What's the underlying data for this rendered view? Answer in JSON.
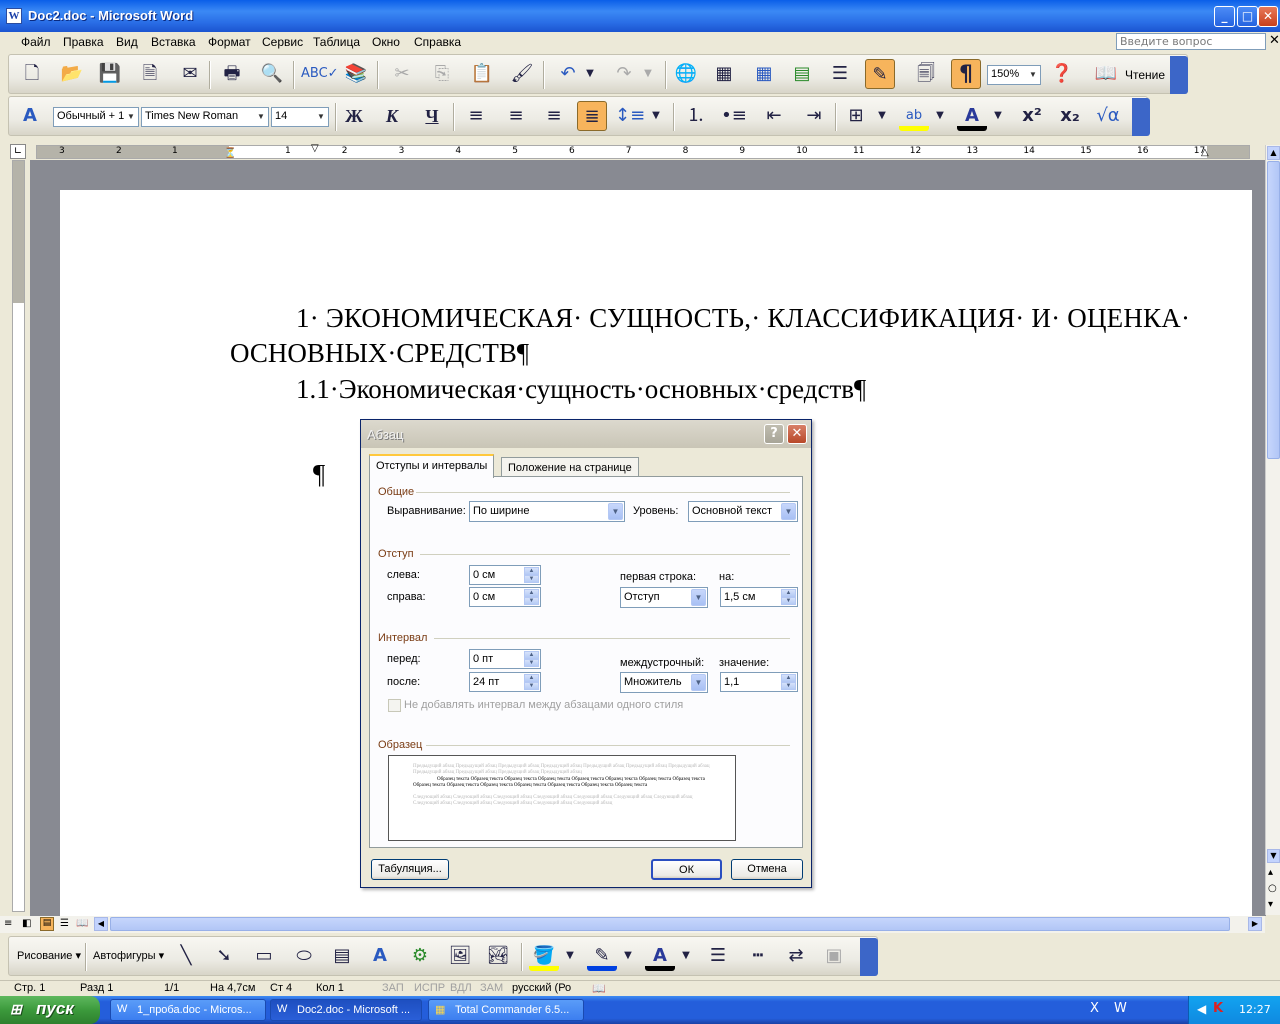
{
  "window": {
    "title": "Doc2.doc - Microsoft Word"
  },
  "menu": {
    "items": [
      "Файл",
      "Правка",
      "Вид",
      "Вставка",
      "Формат",
      "Сервис",
      "Таблица",
      "Окно",
      "Справка"
    ],
    "ask_placeholder": "Введите вопрос"
  },
  "toolbar": {
    "zoom": "150%",
    "reading_label": "Чтение"
  },
  "format_toolbar": {
    "style": "Обычный + 1",
    "font": "Times New Roman",
    "size": "14"
  },
  "ruler": {
    "numbers_left": [
      "3",
      "2",
      "1"
    ],
    "numbers_right": [
      "1",
      "2",
      "3",
      "4",
      "5",
      "6",
      "7",
      "8",
      "9",
      "10",
      "11",
      "12",
      "13",
      "14",
      "15",
      "16",
      "17"
    ]
  },
  "document": {
    "heading_line1": "1· ЭКОНОМИЧЕСКАЯ· СУЩНОСТЬ,· КЛАССИФИКАЦИЯ· И· ОЦЕНКА·",
    "heading_line2": "ОСНОВНЫХ·СРЕДСТВ¶",
    "subheading": "1.1·Экономическая·сущность·основных·средств¶",
    "empty_para": "¶"
  },
  "dialog": {
    "title": "Абзац",
    "tabs": [
      "Отступы и интервалы",
      "Положение на странице"
    ],
    "general": {
      "label": "Общие",
      "alignment_label": "Выравнивание:",
      "alignment_value": "По ширине",
      "level_label": "Уровень:",
      "level_value": "Основной текст"
    },
    "indent": {
      "label": "Отступ",
      "left_label": "слева:",
      "left_value": "0 см",
      "right_label": "справа:",
      "right_value": "0 см",
      "first_line_label": "первая строка:",
      "first_line_value": "Отступ",
      "by_label": "на:",
      "by_value": "1,5 см"
    },
    "spacing": {
      "label": "Интервал",
      "before_label": "перед:",
      "before_value": "0 пт",
      "after_label": "после:",
      "after_value": "24 пт",
      "line_label": "междустрочный:",
      "line_value": "Множитель",
      "at_label": "значение:",
      "at_value": "1,1",
      "no_space_label": "Не добавлять интервал между абзацами одного стиля"
    },
    "preview": {
      "label": "Образец",
      "prev": "Предыдущий абзац Предыдущий абзац Предыдущий абзац Предыдущий абзац Предыдущий абзац Предыдущий абзац Предыдущий абзац Предыдущий абзац Предыдущий абзац Предыдущий абзац Предыдущий абзац",
      "sample": "Образец текста Образец текста Образец текста Образец текста Образец текста Образец текста Образец текста Образец текста Образец текста Образец текста Образец текста Образец текста Образец текста Образец текста Образец текста",
      "next": "Следующий абзац Следующий абзац Следующий абзац Следующий абзац Следующий абзац Следующий абзац Следующий абзац Следующий абзац Следующий абзац Следующий абзац Следующий абзац Следующий абзац"
    },
    "tabs_button": "Табуляция...",
    "ok_button": "ОК",
    "cancel_button": "Отмена"
  },
  "drawing": {
    "draw_label": "Рисование",
    "autoshapes_label": "Автофигуры"
  },
  "status": {
    "page": "Стр. 1",
    "section": "Разд 1",
    "pages": "1/1",
    "at": "На 4,7см",
    "line": "Ст 4",
    "col": "Кол 1",
    "rec": "ЗАП",
    "trk": "ИСПР",
    "ext": "ВДЛ",
    "ovr": "ЗАМ",
    "lang": "русский (Ро"
  },
  "taskbar": {
    "start": "пуск",
    "tasks": [
      "1_проба.doc - Micros...",
      "Doc2.doc - Microsoft ...",
      "Total Commander 6.5..."
    ],
    "clock": "12:27"
  }
}
